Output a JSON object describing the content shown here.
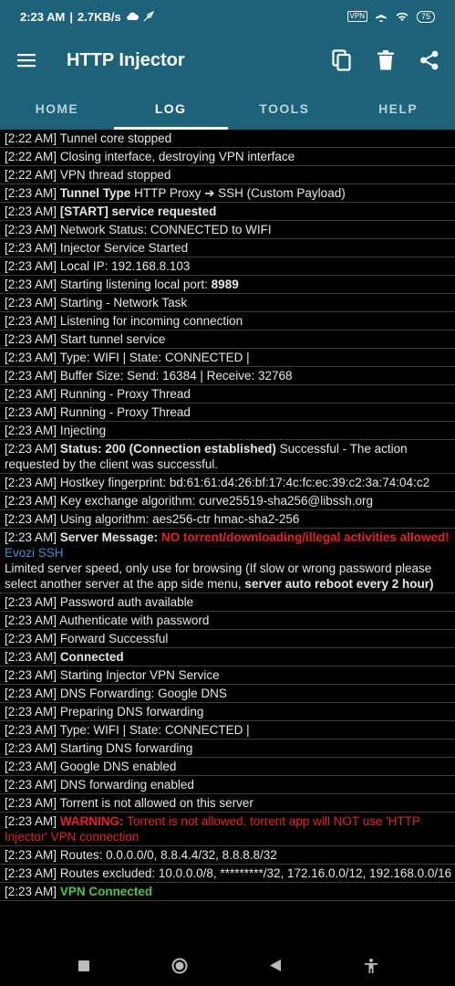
{
  "status_bar": {
    "time": "2:23 AM",
    "speed": "2.7KB/s",
    "vpn_badge": "VPN",
    "battery": "75"
  },
  "app_bar": {
    "title": "HTTP Injector"
  },
  "tabs": [
    {
      "label": "HOME"
    },
    {
      "label": "LOG"
    },
    {
      "label": "TOOLS"
    },
    {
      "label": "HELP"
    }
  ],
  "log": [
    {
      "time": "[2:22 AM]",
      "text": "Tunnel core stopped"
    },
    {
      "time": "[2:22 AM]",
      "text": "Closing interface, destroying VPN interface"
    },
    {
      "time": "[2:22 AM]",
      "text": "VPN thread stopped"
    },
    {
      "time": "[2:23 AM]",
      "bold": "Tunnel Type",
      "text": "HTTP Proxy ➔ SSH (Custom Payload)"
    },
    {
      "time": "[2:23 AM]",
      "bold": "[START] service requested"
    },
    {
      "time": "[2:23 AM]",
      "text": "Network Status: CONNECTED to WIFI"
    },
    {
      "time": "[2:23 AM]",
      "text": "Injector Service Started"
    },
    {
      "time": "[2:23 AM]",
      "text": "Local IP: 192.168.8.103"
    },
    {
      "time": "[2:23 AM]",
      "text": "Starting listening local port:",
      "bold_after": "8989"
    },
    {
      "time": "[2:23 AM]",
      "text": "Starting - Network Task"
    },
    {
      "time": "[2:23 AM]",
      "text": "Listening for incoming connection"
    },
    {
      "time": "[2:23 AM]",
      "text": "Start tunnel service"
    },
    {
      "time": "[2:23 AM]",
      "text": "Type: WIFI | State: CONNECTED |"
    },
    {
      "time": "[2:23 AM]",
      "text": "Buffer Size: Send: 16384 | Receive: 32768"
    },
    {
      "time": "[2:23 AM]",
      "text": "Running - Proxy Thread"
    },
    {
      "time": "[2:23 AM]",
      "text": "Running - Proxy Thread"
    },
    {
      "time": "[2:23 AM]",
      "text": "Injecting"
    },
    {
      "time": "[2:23 AM]",
      "bold": "Status: 200 (Connection established)",
      "text": "Successful - The action requested by the client was successful."
    },
    {
      "time": "[2:23 AM]",
      "text": "Hostkey fingerprint: bd:61:61:d4:26:bf:17:4c:fc:ec:39:c2:3a:74:04:c2"
    },
    {
      "time": "[2:23 AM]",
      "text": "Key exchange algorithm: curve25519-sha256@libssh.org"
    },
    {
      "time": "[2:23 AM]",
      "text": "Using algorithm: aes256-ctr hmac-sha2-256"
    },
    {
      "time": "[2:23 AM]",
      "bold": "Server Message:",
      "red": "NO torrent/downloading/illegal activities allowed!",
      "blue": "Evozi SSH",
      "text2": "Limited server speed, only use for browsing (If slow or wrong password please select another server at the app side menu,",
      "bold2": "server auto reboot every 2 hour)"
    },
    {
      "time": "[2:23 AM]",
      "text": "Password auth available"
    },
    {
      "time": "[2:23 AM]",
      "text": "Authenticate with password"
    },
    {
      "time": "[2:23 AM]",
      "text": "Forward Successful"
    },
    {
      "time": "[2:23 AM]",
      "bold": "Connected"
    },
    {
      "time": "[2:23 AM]",
      "text": "Starting Injector VPN Service"
    },
    {
      "time": "[2:23 AM]",
      "text": "DNS Forwarding: Google DNS"
    },
    {
      "time": "[2:23 AM]",
      "text": "Preparing DNS forwarding"
    },
    {
      "time": "[2:23 AM]",
      "text": "Type: WIFI | State: CONNECTED |"
    },
    {
      "time": "[2:23 AM]",
      "text": "Starting DNS forwarding"
    },
    {
      "time": "[2:23 AM]",
      "text": "Google DNS enabled"
    },
    {
      "time": "[2:23 AM]",
      "text": "DNS forwarding enabled"
    },
    {
      "time": "[2:23 AM]",
      "text": "Torrent is not allowed on this server"
    },
    {
      "time": "[2:23 AM]",
      "red": "WARNING:",
      "red_normal": "Torrent is not allowed, torrent app will NOT use 'HTTP Injector' VPN connection"
    },
    {
      "time": "[2:23 AM]",
      "text": "Routes: 0.0.0.0/0, 8.8.4.4/32, 8.8.8.8/32"
    },
    {
      "time": "[2:23 AM]",
      "text": "Routes excluded: 10.0.0.0/8, *********/32, 172.16.0.0/12, 192.168.0.0/16"
    },
    {
      "time": "[2:23 AM]",
      "green": "VPN Connected"
    }
  ],
  "colors": {
    "primary": "#1d6279",
    "log_bg": "#000000",
    "error": "#e52222",
    "link": "#3b8fd3",
    "success": "#4cc24c"
  }
}
